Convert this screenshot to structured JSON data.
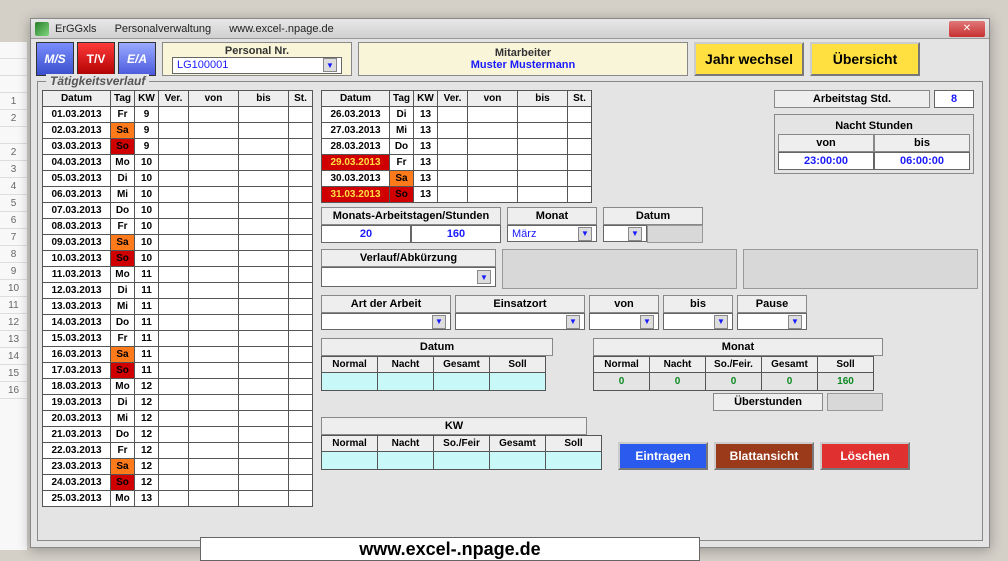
{
  "titlebar": {
    "app": "ErGGxls",
    "section": "Personalverwaltung",
    "url": "www.excel-.npage.de"
  },
  "modes": {
    "ms": "M/S",
    "tv": "T/V",
    "ea": "E/A"
  },
  "personal": {
    "label": "Personal Nr.",
    "value": "LG100001"
  },
  "mitarbeiter": {
    "label": "Mitarbeiter",
    "value": "Muster Mustermann"
  },
  "buttons": {
    "jahr": "Jahr wechsel",
    "uebersicht": "Übersicht",
    "eintragen": "Eintragen",
    "blattansicht": "Blattansicht",
    "loeschen": "Löschen"
  },
  "frame_title": "Tätigkeitsverlauf",
  "headers": {
    "datum": "Datum",
    "tag": "Tag",
    "kw": "KW",
    "ver": "Ver.",
    "von": "von",
    "bis": "bis",
    "st": "St."
  },
  "rows1": [
    {
      "datum": "01.03.2013",
      "tag": "Fr",
      "kw": "9"
    },
    {
      "datum": "02.03.2013",
      "tag": "Sa",
      "kw": "9",
      "cls": "sa"
    },
    {
      "datum": "03.03.2013",
      "tag": "So",
      "kw": "9",
      "cls": "so"
    },
    {
      "datum": "04.03.2013",
      "tag": "Mo",
      "kw": "10"
    },
    {
      "datum": "05.03.2013",
      "tag": "Di",
      "kw": "10"
    },
    {
      "datum": "06.03.2013",
      "tag": "Mi",
      "kw": "10"
    },
    {
      "datum": "07.03.2013",
      "tag": "Do",
      "kw": "10"
    },
    {
      "datum": "08.03.2013",
      "tag": "Fr",
      "kw": "10"
    },
    {
      "datum": "09.03.2013",
      "tag": "Sa",
      "kw": "10",
      "cls": "sa"
    },
    {
      "datum": "10.03.2013",
      "tag": "So",
      "kw": "10",
      "cls": "so"
    },
    {
      "datum": "11.03.2013",
      "tag": "Mo",
      "kw": "11"
    },
    {
      "datum": "12.03.2013",
      "tag": "Di",
      "kw": "11"
    },
    {
      "datum": "13.03.2013",
      "tag": "Mi",
      "kw": "11"
    },
    {
      "datum": "14.03.2013",
      "tag": "Do",
      "kw": "11"
    },
    {
      "datum": "15.03.2013",
      "tag": "Fr",
      "kw": "11"
    },
    {
      "datum": "16.03.2013",
      "tag": "Sa",
      "kw": "11",
      "cls": "sa"
    },
    {
      "datum": "17.03.2013",
      "tag": "So",
      "kw": "11",
      "cls": "so"
    },
    {
      "datum": "18.03.2013",
      "tag": "Mo",
      "kw": "12"
    },
    {
      "datum": "19.03.2013",
      "tag": "Di",
      "kw": "12"
    },
    {
      "datum": "20.03.2013",
      "tag": "Mi",
      "kw": "12"
    },
    {
      "datum": "21.03.2013",
      "tag": "Do",
      "kw": "12"
    },
    {
      "datum": "22.03.2013",
      "tag": "Fr",
      "kw": "12"
    },
    {
      "datum": "23.03.2013",
      "tag": "Sa",
      "kw": "12",
      "cls": "sa"
    },
    {
      "datum": "24.03.2013",
      "tag": "So",
      "kw": "12",
      "cls": "so"
    },
    {
      "datum": "25.03.2013",
      "tag": "Mo",
      "kw": "13"
    }
  ],
  "rows2": [
    {
      "datum": "26.03.2013",
      "tag": "Di",
      "kw": "13"
    },
    {
      "datum": "27.03.2013",
      "tag": "Mi",
      "kw": "13"
    },
    {
      "datum": "28.03.2013",
      "tag": "Do",
      "kw": "13"
    },
    {
      "datum": "29.03.2013",
      "tag": "Fr",
      "kw": "13",
      "dcls": "date-hl"
    },
    {
      "datum": "30.03.2013",
      "tag": "Sa",
      "kw": "13",
      "cls": "sa"
    },
    {
      "datum": "31.03.2013",
      "tag": "So",
      "kw": "13",
      "cls": "so",
      "dcls": "date-hl"
    }
  ],
  "workdays": {
    "label": "Monats-Arbeitstagen/Stunden",
    "days": "20",
    "hours": "160"
  },
  "monat": {
    "label": "Monat",
    "value": "März"
  },
  "datum_sel": {
    "label": "Datum",
    "value": ""
  },
  "arbeitstag": {
    "label": "Arbeitstag Std.",
    "value": "8"
  },
  "nacht": {
    "title": "Nacht Stunden",
    "von_lbl": "von",
    "bis_lbl": "bis",
    "von": "23:00:00",
    "bis": "06:00:00"
  },
  "verlauf": {
    "label": "Verlauf/Abkürzung"
  },
  "art": {
    "label": "Art der Arbeit"
  },
  "einsatz": {
    "label": "Einsatzort"
  },
  "zeit": {
    "von": "von",
    "bis": "bis",
    "pause": "Pause"
  },
  "datum_sum": {
    "title": "Datum",
    "cols": [
      "Normal",
      "Nacht",
      "Gesamt",
      "Soll"
    ]
  },
  "monat_sum": {
    "title": "Monat",
    "cols": [
      "Normal",
      "Nacht",
      "So./Feir.",
      "Gesamt",
      "Soll"
    ],
    "vals": [
      "0",
      "0",
      "0",
      "0",
      "160"
    ],
    "ueber": "Überstunden"
  },
  "kw_sum": {
    "title": "KW",
    "cols": [
      "Normal",
      "Nacht",
      "So./Feir",
      "Gesamt",
      "Soll"
    ]
  },
  "footer": "www.excel-.npage.de",
  "rownums": [
    "",
    "",
    "",
    "1",
    "2",
    "",
    "2",
    "3",
    "4",
    "5",
    "6",
    "7",
    "8",
    "9",
    "10",
    "11",
    "12",
    "13",
    "14",
    "15",
    "16"
  ]
}
